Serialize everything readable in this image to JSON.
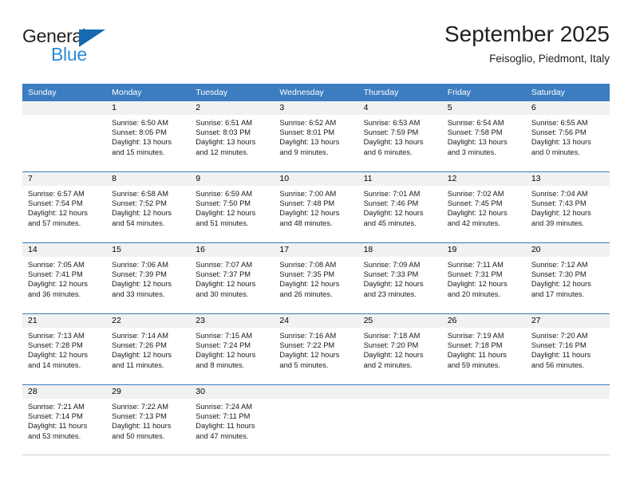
{
  "brand": {
    "name_top": "General",
    "name_bottom": "Blue",
    "triangle_icon": "triangle-icon",
    "color_dark": "#231f20",
    "color_blue": "#2b8ad8",
    "color_triangle": "#156ab0"
  },
  "header": {
    "title": "September 2025",
    "subtitle": "Feisoglio, Piedmont, Italy"
  },
  "theme": {
    "header_bg": "#3b7dc0",
    "header_text": "#ffffff",
    "daynum_band": "#f1f1f1",
    "grid_line": "#3b7dc0"
  },
  "weekdays": [
    "Sunday",
    "Monday",
    "Tuesday",
    "Wednesday",
    "Thursday",
    "Friday",
    "Saturday"
  ],
  "weeks": [
    [
      {
        "day": "",
        "sunrise": "",
        "sunset": "",
        "daylight_line1": "",
        "daylight_line2": ""
      },
      {
        "day": "1",
        "sunrise": "Sunrise: 6:50 AM",
        "sunset": "Sunset: 8:05 PM",
        "daylight_line1": "Daylight: 13 hours",
        "daylight_line2": "and 15 minutes."
      },
      {
        "day": "2",
        "sunrise": "Sunrise: 6:51 AM",
        "sunset": "Sunset: 8:03 PM",
        "daylight_line1": "Daylight: 13 hours",
        "daylight_line2": "and 12 minutes."
      },
      {
        "day": "3",
        "sunrise": "Sunrise: 6:52 AM",
        "sunset": "Sunset: 8:01 PM",
        "daylight_line1": "Daylight: 13 hours",
        "daylight_line2": "and 9 minutes."
      },
      {
        "day": "4",
        "sunrise": "Sunrise: 6:53 AM",
        "sunset": "Sunset: 7:59 PM",
        "daylight_line1": "Daylight: 13 hours",
        "daylight_line2": "and 6 minutes."
      },
      {
        "day": "5",
        "sunrise": "Sunrise: 6:54 AM",
        "sunset": "Sunset: 7:58 PM",
        "daylight_line1": "Daylight: 13 hours",
        "daylight_line2": "and 3 minutes."
      },
      {
        "day": "6",
        "sunrise": "Sunrise: 6:55 AM",
        "sunset": "Sunset: 7:56 PM",
        "daylight_line1": "Daylight: 13 hours",
        "daylight_line2": "and 0 minutes."
      }
    ],
    [
      {
        "day": "7",
        "sunrise": "Sunrise: 6:57 AM",
        "sunset": "Sunset: 7:54 PM",
        "daylight_line1": "Daylight: 12 hours",
        "daylight_line2": "and 57 minutes."
      },
      {
        "day": "8",
        "sunrise": "Sunrise: 6:58 AM",
        "sunset": "Sunset: 7:52 PM",
        "daylight_line1": "Daylight: 12 hours",
        "daylight_line2": "and 54 minutes."
      },
      {
        "day": "9",
        "sunrise": "Sunrise: 6:59 AM",
        "sunset": "Sunset: 7:50 PM",
        "daylight_line1": "Daylight: 12 hours",
        "daylight_line2": "and 51 minutes."
      },
      {
        "day": "10",
        "sunrise": "Sunrise: 7:00 AM",
        "sunset": "Sunset: 7:48 PM",
        "daylight_line1": "Daylight: 12 hours",
        "daylight_line2": "and 48 minutes."
      },
      {
        "day": "11",
        "sunrise": "Sunrise: 7:01 AM",
        "sunset": "Sunset: 7:46 PM",
        "daylight_line1": "Daylight: 12 hours",
        "daylight_line2": "and 45 minutes."
      },
      {
        "day": "12",
        "sunrise": "Sunrise: 7:02 AM",
        "sunset": "Sunset: 7:45 PM",
        "daylight_line1": "Daylight: 12 hours",
        "daylight_line2": "and 42 minutes."
      },
      {
        "day": "13",
        "sunrise": "Sunrise: 7:04 AM",
        "sunset": "Sunset: 7:43 PM",
        "daylight_line1": "Daylight: 12 hours",
        "daylight_line2": "and 39 minutes."
      }
    ],
    [
      {
        "day": "14",
        "sunrise": "Sunrise: 7:05 AM",
        "sunset": "Sunset: 7:41 PM",
        "daylight_line1": "Daylight: 12 hours",
        "daylight_line2": "and 36 minutes."
      },
      {
        "day": "15",
        "sunrise": "Sunrise: 7:06 AM",
        "sunset": "Sunset: 7:39 PM",
        "daylight_line1": "Daylight: 12 hours",
        "daylight_line2": "and 33 minutes."
      },
      {
        "day": "16",
        "sunrise": "Sunrise: 7:07 AM",
        "sunset": "Sunset: 7:37 PM",
        "daylight_line1": "Daylight: 12 hours",
        "daylight_line2": "and 30 minutes."
      },
      {
        "day": "17",
        "sunrise": "Sunrise: 7:08 AM",
        "sunset": "Sunset: 7:35 PM",
        "daylight_line1": "Daylight: 12 hours",
        "daylight_line2": "and 26 minutes."
      },
      {
        "day": "18",
        "sunrise": "Sunrise: 7:09 AM",
        "sunset": "Sunset: 7:33 PM",
        "daylight_line1": "Daylight: 12 hours",
        "daylight_line2": "and 23 minutes."
      },
      {
        "day": "19",
        "sunrise": "Sunrise: 7:11 AM",
        "sunset": "Sunset: 7:31 PM",
        "daylight_line1": "Daylight: 12 hours",
        "daylight_line2": "and 20 minutes."
      },
      {
        "day": "20",
        "sunrise": "Sunrise: 7:12 AM",
        "sunset": "Sunset: 7:30 PM",
        "daylight_line1": "Daylight: 12 hours",
        "daylight_line2": "and 17 minutes."
      }
    ],
    [
      {
        "day": "21",
        "sunrise": "Sunrise: 7:13 AM",
        "sunset": "Sunset: 7:28 PM",
        "daylight_line1": "Daylight: 12 hours",
        "daylight_line2": "and 14 minutes."
      },
      {
        "day": "22",
        "sunrise": "Sunrise: 7:14 AM",
        "sunset": "Sunset: 7:26 PM",
        "daylight_line1": "Daylight: 12 hours",
        "daylight_line2": "and 11 minutes."
      },
      {
        "day": "23",
        "sunrise": "Sunrise: 7:15 AM",
        "sunset": "Sunset: 7:24 PM",
        "daylight_line1": "Daylight: 12 hours",
        "daylight_line2": "and 8 minutes."
      },
      {
        "day": "24",
        "sunrise": "Sunrise: 7:16 AM",
        "sunset": "Sunset: 7:22 PM",
        "daylight_line1": "Daylight: 12 hours",
        "daylight_line2": "and 5 minutes."
      },
      {
        "day": "25",
        "sunrise": "Sunrise: 7:18 AM",
        "sunset": "Sunset: 7:20 PM",
        "daylight_line1": "Daylight: 12 hours",
        "daylight_line2": "and 2 minutes."
      },
      {
        "day": "26",
        "sunrise": "Sunrise: 7:19 AM",
        "sunset": "Sunset: 7:18 PM",
        "daylight_line1": "Daylight: 11 hours",
        "daylight_line2": "and 59 minutes."
      },
      {
        "day": "27",
        "sunrise": "Sunrise: 7:20 AM",
        "sunset": "Sunset: 7:16 PM",
        "daylight_line1": "Daylight: 11 hours",
        "daylight_line2": "and 56 minutes."
      }
    ],
    [
      {
        "day": "28",
        "sunrise": "Sunrise: 7:21 AM",
        "sunset": "Sunset: 7:14 PM",
        "daylight_line1": "Daylight: 11 hours",
        "daylight_line2": "and 53 minutes."
      },
      {
        "day": "29",
        "sunrise": "Sunrise: 7:22 AM",
        "sunset": "Sunset: 7:13 PM",
        "daylight_line1": "Daylight: 11 hours",
        "daylight_line2": "and 50 minutes."
      },
      {
        "day": "30",
        "sunrise": "Sunrise: 7:24 AM",
        "sunset": "Sunset: 7:11 PM",
        "daylight_line1": "Daylight: 11 hours",
        "daylight_line2": "and 47 minutes."
      },
      {
        "day": "",
        "sunrise": "",
        "sunset": "",
        "daylight_line1": "",
        "daylight_line2": ""
      },
      {
        "day": "",
        "sunrise": "",
        "sunset": "",
        "daylight_line1": "",
        "daylight_line2": ""
      },
      {
        "day": "",
        "sunrise": "",
        "sunset": "",
        "daylight_line1": "",
        "daylight_line2": ""
      },
      {
        "day": "",
        "sunrise": "",
        "sunset": "",
        "daylight_line1": "",
        "daylight_line2": ""
      }
    ]
  ]
}
